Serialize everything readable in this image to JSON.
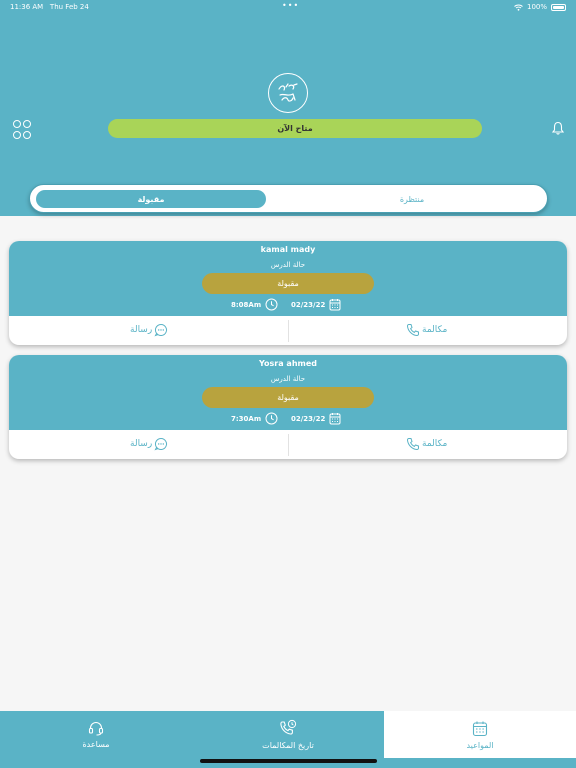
{
  "status_bar": {
    "time": "11:36 AM",
    "date": "Thu Feb 24",
    "battery": "100%"
  },
  "header": {
    "availability": "متاح الآن"
  },
  "segments": {
    "accepted": "مقبولة",
    "pending": "منتظرة"
  },
  "appointments": [
    {
      "name": "kamal mady",
      "lesson_label": "حالة الدرس",
      "state": "مقبولة",
      "date": "02/23/22",
      "time": "8:08Am",
      "call_label": "مكالمة",
      "message_label": "رسالة"
    },
    {
      "name": "Yosra ahmed",
      "lesson_label": "حالة الدرس",
      "state": "مقبولة",
      "date": "02/23/22",
      "time": "7:30Am",
      "call_label": "مكالمة",
      "message_label": "رسالة"
    }
  ],
  "tabbar": {
    "help": "مساعدة",
    "call_history": "تاريخ المكالمات",
    "appointments": "المواعيد"
  },
  "colors": {
    "primary": "#5ab3c6",
    "availability": "#a9d458",
    "accepted_badge": "#b8a33e"
  }
}
